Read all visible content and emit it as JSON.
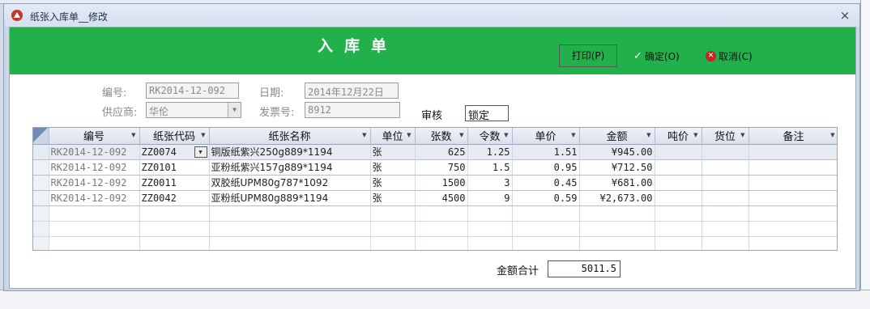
{
  "window": {
    "title": "纸张入库单__修改",
    "close_glyph": "×"
  },
  "header": {
    "heading": "入库单",
    "print_label": "打印(P)",
    "ok_label": "确定(O)",
    "cancel_label": "取消(C)",
    "band_color": "#22b04b"
  },
  "form": {
    "number_label": "编号:",
    "number_value": "RK2014-12-092",
    "date_label": "日期:",
    "date_value": "2014年12月22日",
    "supplier_label": "供应商:",
    "supplier_value": "华伦",
    "invoice_label": "发票号:",
    "invoice_value": "8912",
    "audit_label": "审核",
    "audit_value": "锁定"
  },
  "grid": {
    "columns": [
      "编号",
      "纸张代码",
      "纸张名称",
      "单位",
      "张数",
      "令数",
      "单价",
      "金额",
      "吨价",
      "货位",
      "备注"
    ],
    "rows": [
      [
        "RK2014-12-092",
        "ZZ0074",
        "铜版纸紫兴250g889*1194",
        "张",
        "625",
        "1.25",
        "1.51",
        "¥945.00",
        "",
        "",
        ""
      ],
      [
        "RK2014-12-092",
        "ZZ0101",
        "亚粉纸紫兴157g889*1194",
        "张",
        "750",
        "1.5",
        "0.95",
        "¥712.50",
        "",
        "",
        ""
      ],
      [
        "RK2014-12-092",
        "ZZ0011",
        "双胶纸UPM80g787*1092",
        "张",
        "1500",
        "3",
        "0.45",
        "¥681.00",
        "",
        "",
        ""
      ],
      [
        "RK2014-12-092",
        "ZZ0042",
        "亚粉纸UPM80g889*1194",
        "张",
        "4500",
        "9",
        "0.59",
        "¥2,673.00",
        "",
        "",
        ""
      ]
    ]
  },
  "footer": {
    "total_label": "金额合计",
    "total_value": "5011.5"
  }
}
